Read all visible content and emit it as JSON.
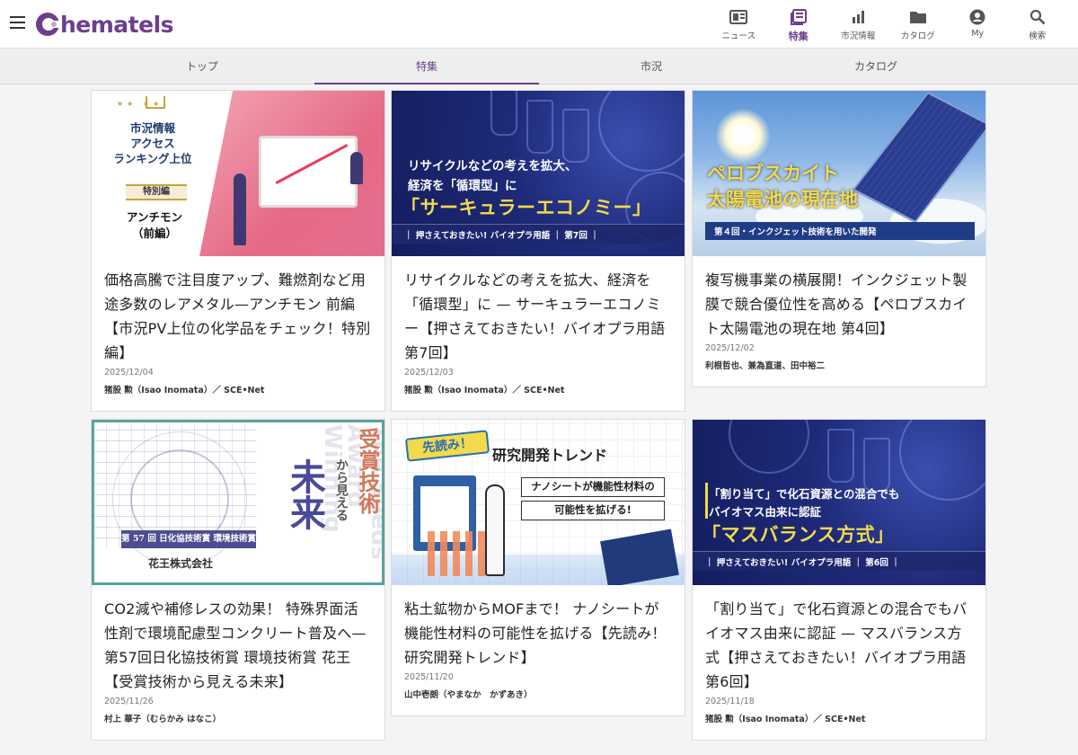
{
  "brand": {
    "name": "hematels",
    "accent": "#6b3f8e"
  },
  "topnav": [
    {
      "label": "ニュース",
      "icon": "newspaper-icon"
    },
    {
      "label": "特集",
      "icon": "feature-icon",
      "active": true
    },
    {
      "label": "市況情報",
      "icon": "bar-chart-icon"
    },
    {
      "label": "カタログ",
      "icon": "folder-icon"
    },
    {
      "label": "My",
      "icon": "account-icon"
    },
    {
      "label": "検索",
      "icon": "search-icon"
    }
  ],
  "subtabs": [
    {
      "label": "トップ"
    },
    {
      "label": "特集",
      "active": true
    },
    {
      "label": "市況"
    },
    {
      "label": "カタログ"
    }
  ],
  "cards": [
    {
      "title": "価格高騰で注目度アップ、難燃剤など用途多数のレアメタル—アンチモン 前編【市況PV上位の化学品をチェック！特別編】",
      "date": "2025/12/04",
      "author": "猪股 勲（Isao Inomata）／ SCE•Net",
      "thumb": {
        "heading": "市況情報\nアクセス\nランキング上位",
        "ribbon": "特別編",
        "name": "アンチモン\n（前編）"
      }
    },
    {
      "title": "リサイクルなどの考えを拡大、経済を「循環型」に — サーキュラーエコノミー【押さえておきたい！バイオプラ用語 第7回】",
      "date": "2025/12/03",
      "author": "猪股 勲（Isao Inomata）／ SCE•Net",
      "thumb": {
        "line1": "リサイクルなどの考えを拡大、",
        "line2": "経済を「循環型」に",
        "big": "「サーキュラーエコノミー」",
        "bar": "｜ 押さえておきたい! バイオプラ用語 ｜ 第7回 ｜"
      }
    },
    {
      "title": "複写機事業の横展開！インクジェット製膜で競合優位性を高める【ペロブスカイト太陽電池の現在地 第4回】",
      "date": "2025/12/02",
      "author": "利根哲也、兼為直道、田中裕二",
      "thumb": {
        "title1": "ペロブスカイト",
        "title2": "太陽電池の現在地",
        "bar": "第４回・インクジェット技術を用いた開発"
      }
    },
    {
      "title": "CO2減や補修レスの効果！ 特殊界面活性剤で環境配慮型コンクリート普及へ—第57回日化協技術賞 環境技術賞 花王【受賞技術から見える未来】",
      "date": "2025/11/26",
      "author": "村上 華子（むらかみ はなこ）",
      "thumb": {
        "kanji1": "受賞技術",
        "kanji2": "から見える",
        "kanji3": "未来",
        "ghost": "The Seeds Award Winning",
        "label": "第 57 回 日化協技術賞 環境技術賞",
        "company": "花王株式会社"
      }
    },
    {
      "title": "粘土鉱物からMOFまで！ ナノシートが機能性材料の可能性を拡げる【先読み！研究開発トレンド】",
      "date": "2025/11/20",
      "author": "山中壱朗（やまなか　かずあき）",
      "thumb": {
        "badge": "先読み！",
        "trend": "研究開発トレンド",
        "box1": "ナノシートが機能性材料の",
        "box2": "可能性を拡げる!"
      }
    },
    {
      "title": "「割り当て」で化石資源との混合でもバイオマス由来に認証 — マスバランス方式【押さえておきたい！バイオプラ用語 第6回】",
      "date": "2025/11/18",
      "author": "猪股 勲（Isao Inomata）／ SCE•Net",
      "thumb": {
        "line1": "「割り当て」で化石資源との混合でも",
        "line2": "バイオマス由来に認証",
        "big": "「マスバランス方式」",
        "bar": "｜ 押さえておきたい! バイオプラ用語 ｜ 第6回 ｜"
      }
    }
  ]
}
